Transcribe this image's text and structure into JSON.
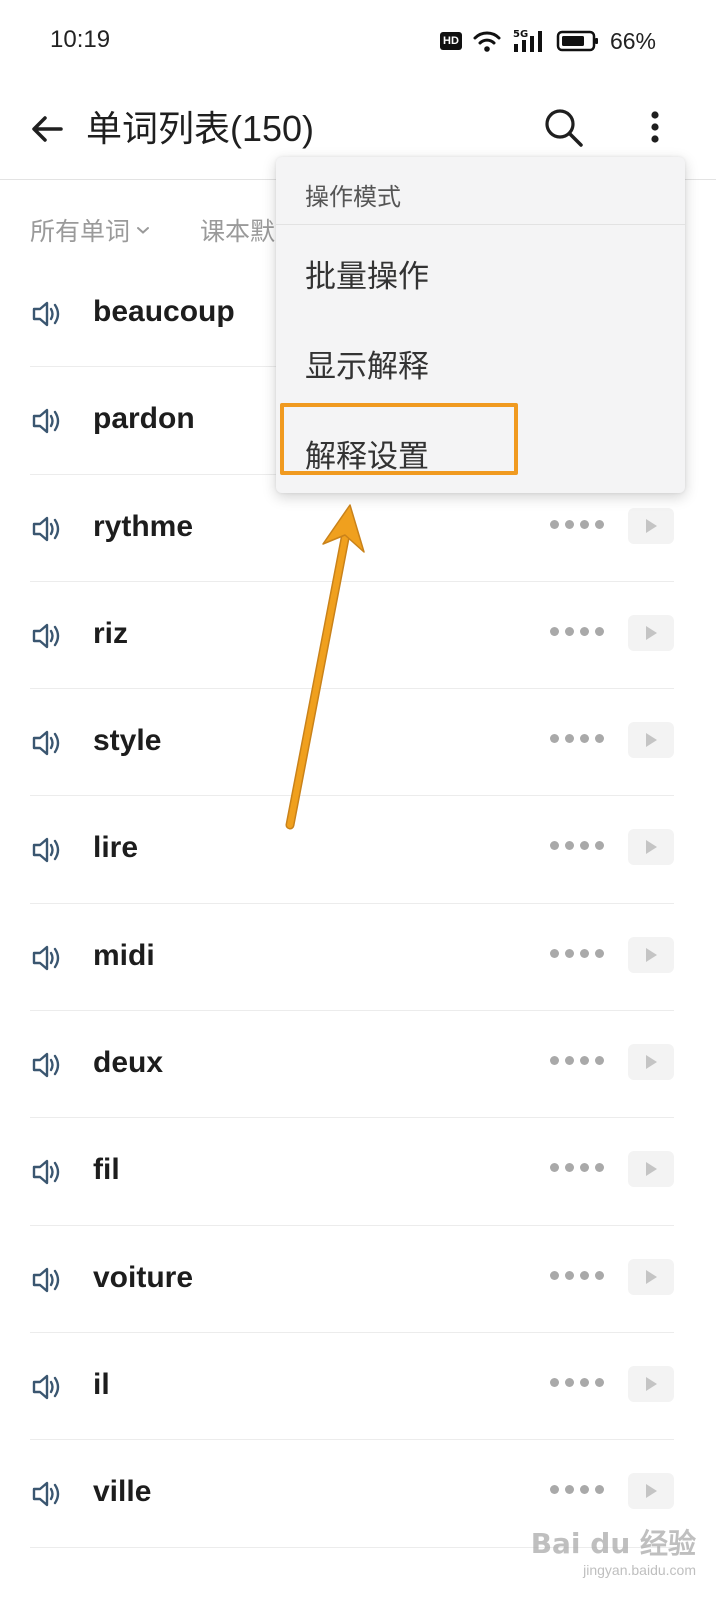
{
  "status_bar": {
    "time": "10:19",
    "hd_badge": "HD",
    "network": "5G",
    "battery": "66%"
  },
  "app_bar": {
    "title": "单词列表(150)"
  },
  "filters": {
    "primary": "所有单词",
    "secondary": "课本默"
  },
  "words": [
    "beaucoup",
    "pardon",
    "rythme",
    "riz",
    "style",
    "lire",
    "midi",
    "deux",
    "fil",
    "voiture",
    "il",
    "ville"
  ],
  "popup_menu": {
    "header": "操作模式",
    "items": [
      "批量操作",
      "显示解释",
      "解释设置"
    ],
    "highlighted_item": "解释设置",
    "highlight_color": "#f09a20"
  },
  "accent": {
    "speaker": "#3a5670",
    "arrow": "#f0a01e"
  },
  "watermark": {
    "logo": "Bai du 经验",
    "sub": "jingyan.baidu.com"
  }
}
